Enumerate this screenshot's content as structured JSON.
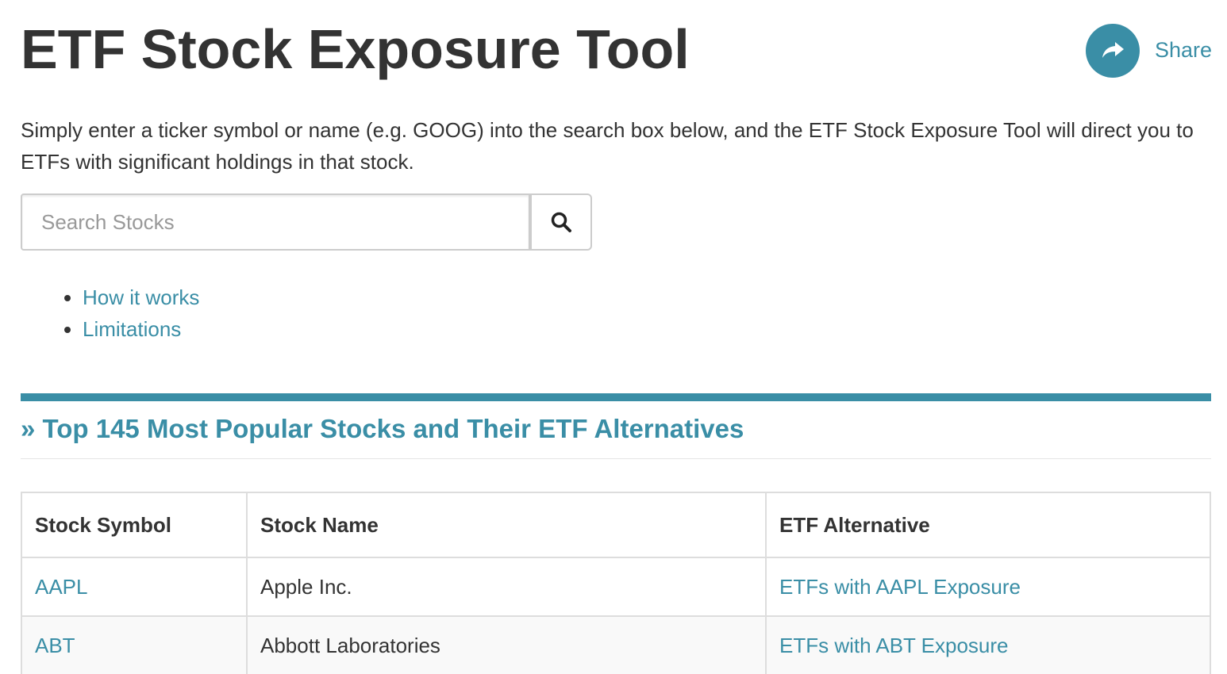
{
  "page": {
    "title": "ETF Stock Exposure Tool",
    "share_label": "Share",
    "share_icon": "share-arrow-icon",
    "intro": "Simply enter a ticker symbol or name (e.g. GOOG) into the search box below, and the ETF Stock Exposure Tool will direct you to ETFs with significant holdings in that stock.",
    "accent_color": "#3a8ea6"
  },
  "search": {
    "placeholder": "Search Stocks",
    "value": "",
    "button_icon": "search-icon"
  },
  "links": [
    {
      "label": "How it works"
    },
    {
      "label": "Limitations"
    }
  ],
  "section": {
    "title": "» Top 145 Most Popular Stocks and Their ETF Alternatives"
  },
  "table": {
    "headers": [
      "Stock Symbol",
      "Stock Name",
      "ETF Alternative"
    ],
    "rows": [
      {
        "symbol": "AAPL",
        "name": "Apple Inc.",
        "etf": "ETFs with AAPL Exposure"
      },
      {
        "symbol": "ABT",
        "name": "Abbott Laboratories",
        "etf": "ETFs with ABT Exposure"
      }
    ]
  }
}
